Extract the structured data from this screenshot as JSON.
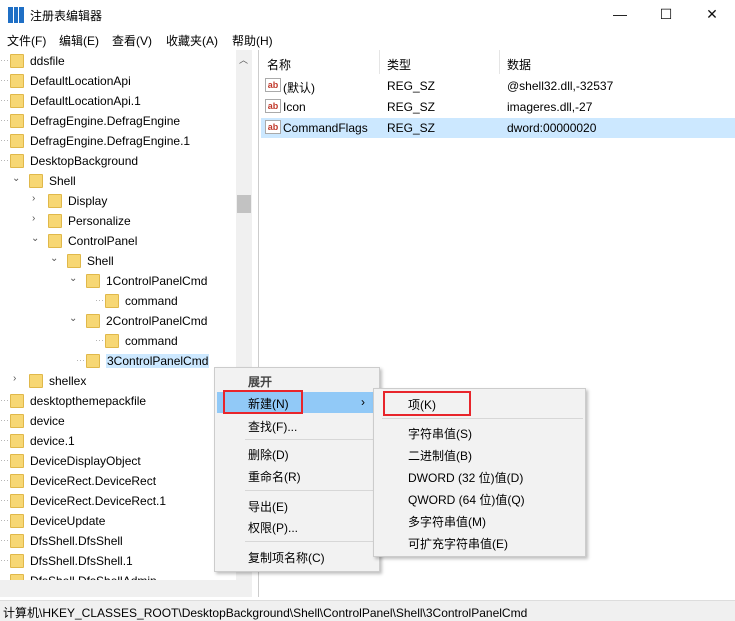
{
  "window": {
    "title": "注册表编辑器",
    "minimize": "—",
    "maximize": "☐",
    "close": "✕"
  },
  "menubar": [
    "文件(F)",
    "编辑(E)",
    "查看(V)",
    "收藏夹(A)",
    "帮助(H)"
  ],
  "tree": [
    {
      "label": "ddsfile",
      "level": 0,
      "state": "leaf"
    },
    {
      "label": "DefaultLocationApi",
      "level": 0,
      "state": "leaf"
    },
    {
      "label": "DefaultLocationApi.1",
      "level": 0,
      "state": "leaf"
    },
    {
      "label": "DefragEngine.DefragEngine",
      "level": 0,
      "state": "leaf"
    },
    {
      "label": "DefragEngine.DefragEngine.1",
      "level": 0,
      "state": "leaf"
    },
    {
      "label": "DesktopBackground",
      "level": 0,
      "state": "leaf"
    },
    {
      "label": "Shell",
      "level": 1,
      "state": "expanded"
    },
    {
      "label": "Display",
      "level": 2,
      "state": "collapsed"
    },
    {
      "label": "Personalize",
      "level": 2,
      "state": "collapsed"
    },
    {
      "label": "ControlPanel",
      "level": 2,
      "state": "expanded"
    },
    {
      "label": "Shell",
      "level": 3,
      "state": "expanded"
    },
    {
      "label": "1ControlPanelCmd",
      "level": 4,
      "state": "expanded"
    },
    {
      "label": "command",
      "level": 5,
      "state": "leaf"
    },
    {
      "label": "2ControlPanelCmd",
      "level": 4,
      "state": "expanded"
    },
    {
      "label": "command",
      "level": 5,
      "state": "leaf"
    },
    {
      "label": "3ControlPanelCmd",
      "level": 4,
      "state": "selected"
    },
    {
      "label": "shellex",
      "level": 1,
      "state": "collapsed"
    },
    {
      "label": "desktopthemepackfile",
      "level": 0,
      "state": "leaf"
    },
    {
      "label": "device",
      "level": 0,
      "state": "leaf"
    },
    {
      "label": "device.1",
      "level": 0,
      "state": "leaf"
    },
    {
      "label": "DeviceDisplayObject",
      "level": 0,
      "state": "leaf"
    },
    {
      "label": "DeviceRect.DeviceRect",
      "level": 0,
      "state": "leaf"
    },
    {
      "label": "DeviceRect.DeviceRect.1",
      "level": 0,
      "state": "leaf"
    },
    {
      "label": "DeviceUpdate",
      "level": 0,
      "state": "leaf"
    },
    {
      "label": "DfsShell.DfsShell",
      "level": 0,
      "state": "leaf"
    },
    {
      "label": "DfsShell.DfsShell.1",
      "level": 0,
      "state": "leaf"
    },
    {
      "label": "DfsShell.DfsShellAdmin",
      "level": 0,
      "state": "leaf"
    }
  ],
  "values": {
    "headers": [
      "名称",
      "类型",
      "数据"
    ],
    "rows": [
      {
        "name": "(默认)",
        "type": "REG_SZ",
        "data": "@shell32.dll,-32537"
      },
      {
        "name": "Icon",
        "type": "REG_SZ",
        "data": "imageres.dll,-27"
      },
      {
        "name": "CommandFlags",
        "type": "REG_SZ",
        "data": "dword:00000020",
        "selected": true
      }
    ],
    "icon": "ab"
  },
  "context_menu": [
    "展开",
    "新建(N)",
    "查找(F)...",
    "删除(D)",
    "重命名(R)",
    "导出(E)",
    "权限(P)...",
    "复制项名称(C)"
  ],
  "submenu": [
    "项(K)",
    "字符串值(S)",
    "二进制值(B)",
    "DWORD (32 位)值(D)",
    "QWORD (64 位)值(Q)",
    "多字符串值(M)",
    "可扩充字符串值(E)"
  ],
  "statusbar": "计算机\\HKEY_CLASSES_ROOT\\DesktopBackground\\Shell\\ControlPanel\\Shell\\3ControlPanelCmd",
  "colors": {
    "highlight": "#91c9f7",
    "selection": "#cce8ff",
    "annotation": "#e8252b"
  }
}
